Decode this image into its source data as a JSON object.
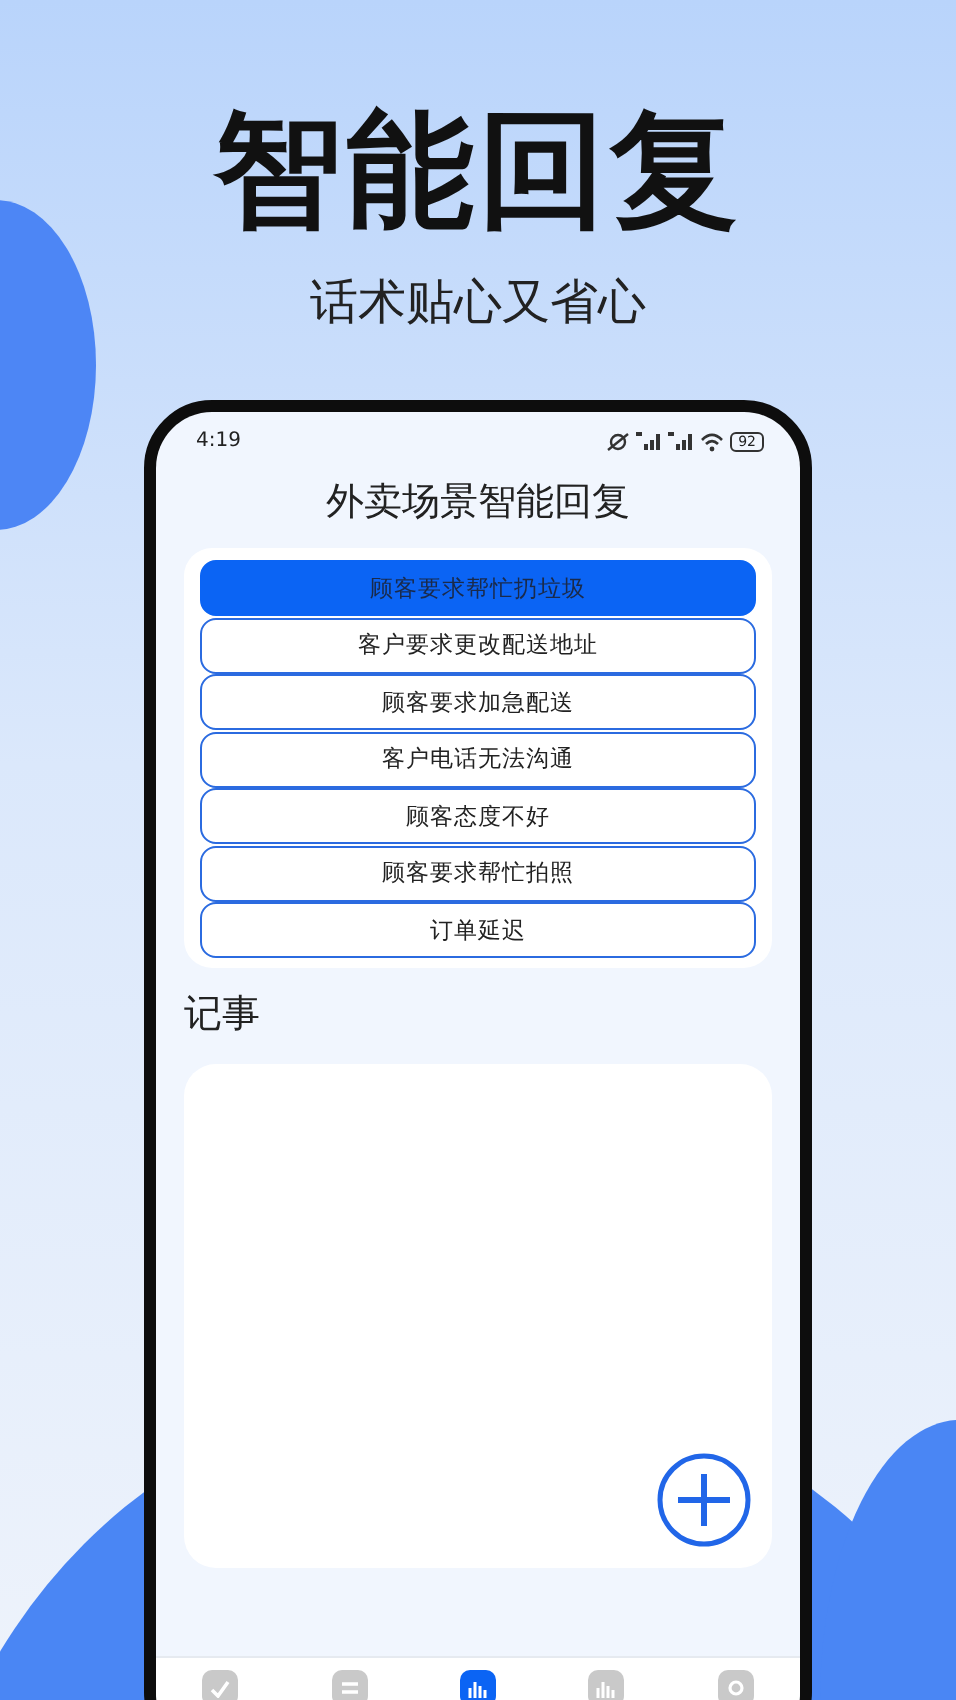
{
  "headline": "智能回复",
  "subheadline": "话术贴心又省心",
  "status_bar": {
    "time": "4:19",
    "battery": "92"
  },
  "screen_title": "外卖场景智能回复",
  "replies": [
    {
      "label": "顾客要求帮忙扔垃圾",
      "selected": true
    },
    {
      "label": "客户要求更改配送地址",
      "selected": false
    },
    {
      "label": "顾客要求加急配送",
      "selected": false
    },
    {
      "label": "客户电话无法沟通",
      "selected": false
    },
    {
      "label": "顾客态度不好",
      "selected": false
    },
    {
      "label": "顾客要求帮忙拍照",
      "selected": false
    },
    {
      "label": "订单延迟",
      "selected": false
    }
  ],
  "notes_heading": "记事",
  "tabs": [
    {
      "kind": "check",
      "selected": false
    },
    {
      "kind": "list",
      "selected": false
    },
    {
      "kind": "bars",
      "selected": true
    },
    {
      "kind": "bars",
      "selected": false
    },
    {
      "kind": "search",
      "selected": false
    }
  ]
}
